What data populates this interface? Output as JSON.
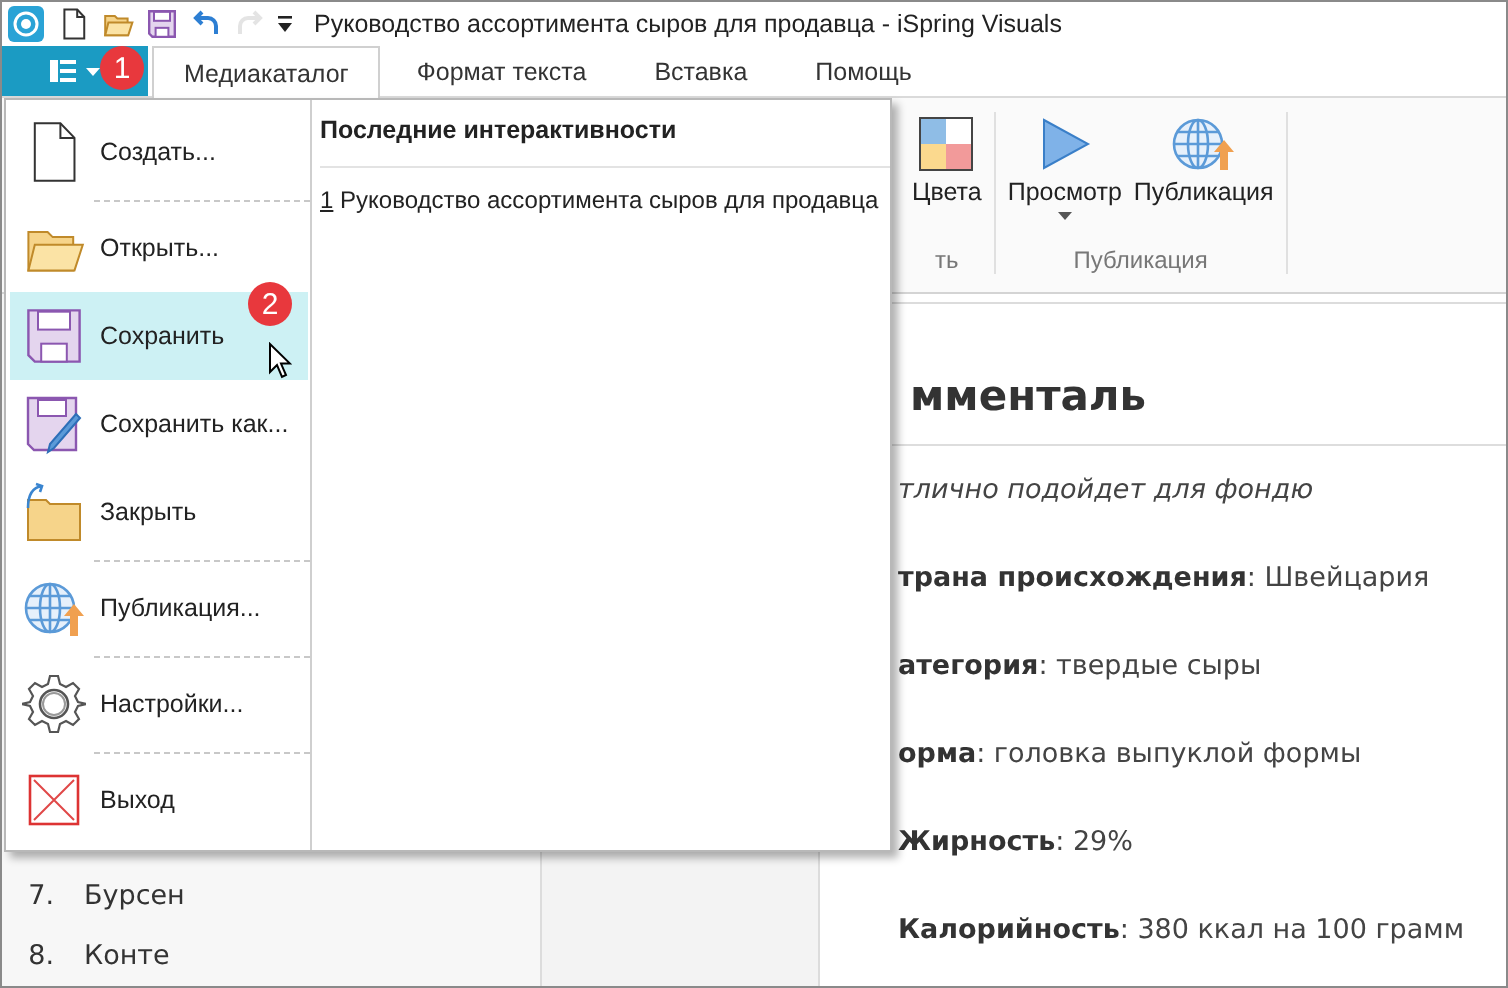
{
  "window": {
    "title": "Руководство ассортимента сыров для продавца - iSpring Visuals"
  },
  "quick_access": [
    {
      "kind": "new",
      "disabled": false
    },
    {
      "kind": "open",
      "disabled": false
    },
    {
      "kind": "save",
      "disabled": false
    },
    {
      "kind": "undo",
      "disabled": false
    },
    {
      "kind": "redo",
      "disabled": true
    },
    {
      "kind": "customize",
      "disabled": false
    }
  ],
  "tabs": [
    {
      "label": "Медиакаталог",
      "selected": true
    },
    {
      "label": "Формат текста",
      "selected": false
    },
    {
      "label": "Вставка",
      "selected": false
    },
    {
      "label": "Помощь",
      "selected": false
    }
  ],
  "ribbon": {
    "groups": [
      {
        "label": "ть",
        "buttons": [
          {
            "kind": "colors",
            "label": "Цвета",
            "dropdown": false
          }
        ]
      },
      {
        "label": "Публикация",
        "buttons": [
          {
            "kind": "preview",
            "label": "Просмотр",
            "dropdown": true
          },
          {
            "kind": "publish",
            "label": "Публикация",
            "dropdown": false
          }
        ]
      }
    ]
  },
  "outline": {
    "items": [
      {
        "number": "7.",
        "label": "Бурсен"
      },
      {
        "number": "8.",
        "label": "Конте"
      }
    ]
  },
  "article": {
    "heading": "мменталь",
    "paragraphs": [
      {
        "kind": "note",
        "text": "тлично подойдет для фондю"
      },
      {
        "kind": "fact",
        "text": "**трана происхождения**: Швейцария"
      },
      {
        "kind": "fact",
        "text": "**атегория**: твердые сыры"
      },
      {
        "kind": "fact",
        "text": "**орма**: головка выпуклой формы"
      },
      {
        "kind": "fact",
        "text": "**Жирность**: 29%"
      },
      {
        "kind": "fact",
        "text": "**Калорийность**: 380 ккал на 100 грамм"
      }
    ]
  },
  "file_menu": {
    "groups": [
      {
        "items": [
          {
            "label": "Создать...",
            "selected": false
          }
        ]
      },
      {
        "items": [
          {
            "label": "Открыть...",
            "selected": false
          },
          {
            "label": "Сохранить",
            "selected": true
          },
          {
            "label": "Сохранить как...",
            "selected": false
          },
          {
            "label": "Закрыть",
            "selected": false
          }
        ]
      },
      {
        "items": [
          {
            "label": "Публикация...",
            "selected": false
          }
        ]
      },
      {
        "items": [
          {
            "label": "Настройки...",
            "selected": false
          }
        ]
      },
      {
        "items": [
          {
            "label": "Выход",
            "selected": false
          }
        ]
      }
    ],
    "recent": {
      "title": "Последние интерактивности",
      "items": [
        {
          "number": "1",
          "label": "Руководство ассортимента сыров для продавца"
        }
      ]
    }
  },
  "annotations": [
    {
      "label": "1"
    },
    {
      "label": "2"
    }
  ]
}
